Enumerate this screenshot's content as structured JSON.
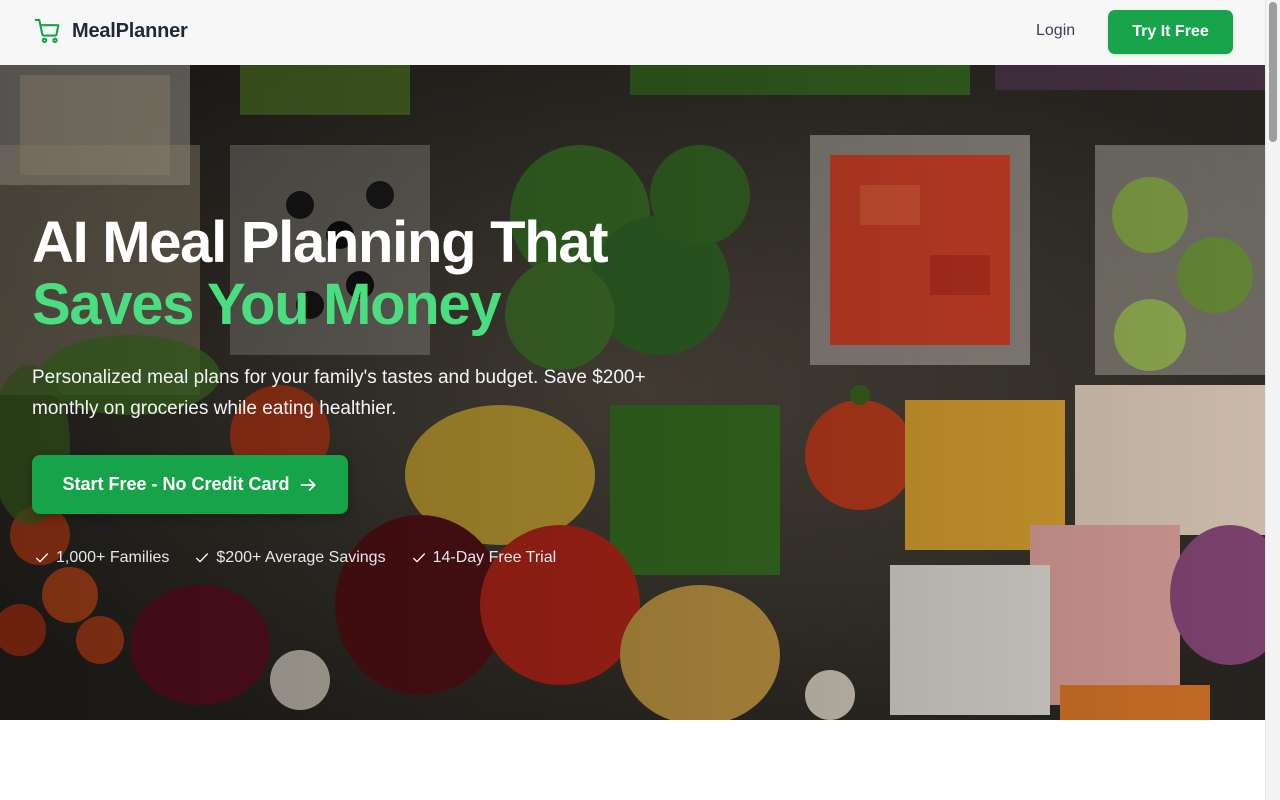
{
  "header": {
    "brand": "MealPlanner",
    "brand_icon": "shopping-cart-icon",
    "login_label": "Login",
    "cta_label": "Try It Free"
  },
  "hero": {
    "title_line1": "AI Meal Planning That",
    "title_line2": "Saves You Money",
    "subtitle": "Personalized meal plans for your family's tastes and budget. Save $200+ monthly on groceries while eating healthier.",
    "cta_label": "Start Free - No Credit Card",
    "cta_icon": "arrow-right-icon",
    "badges": [
      {
        "icon": "check-icon",
        "label": "1,000+ Families"
      },
      {
        "icon": "check-icon",
        "label": "$200+ Average Savings"
      },
      {
        "icon": "check-icon",
        "label": "14-Day Free Trial"
      }
    ]
  },
  "colors": {
    "accent": "#16a34a",
    "accent_text": "#4ade80",
    "header_bg": "#f7f7f7"
  }
}
